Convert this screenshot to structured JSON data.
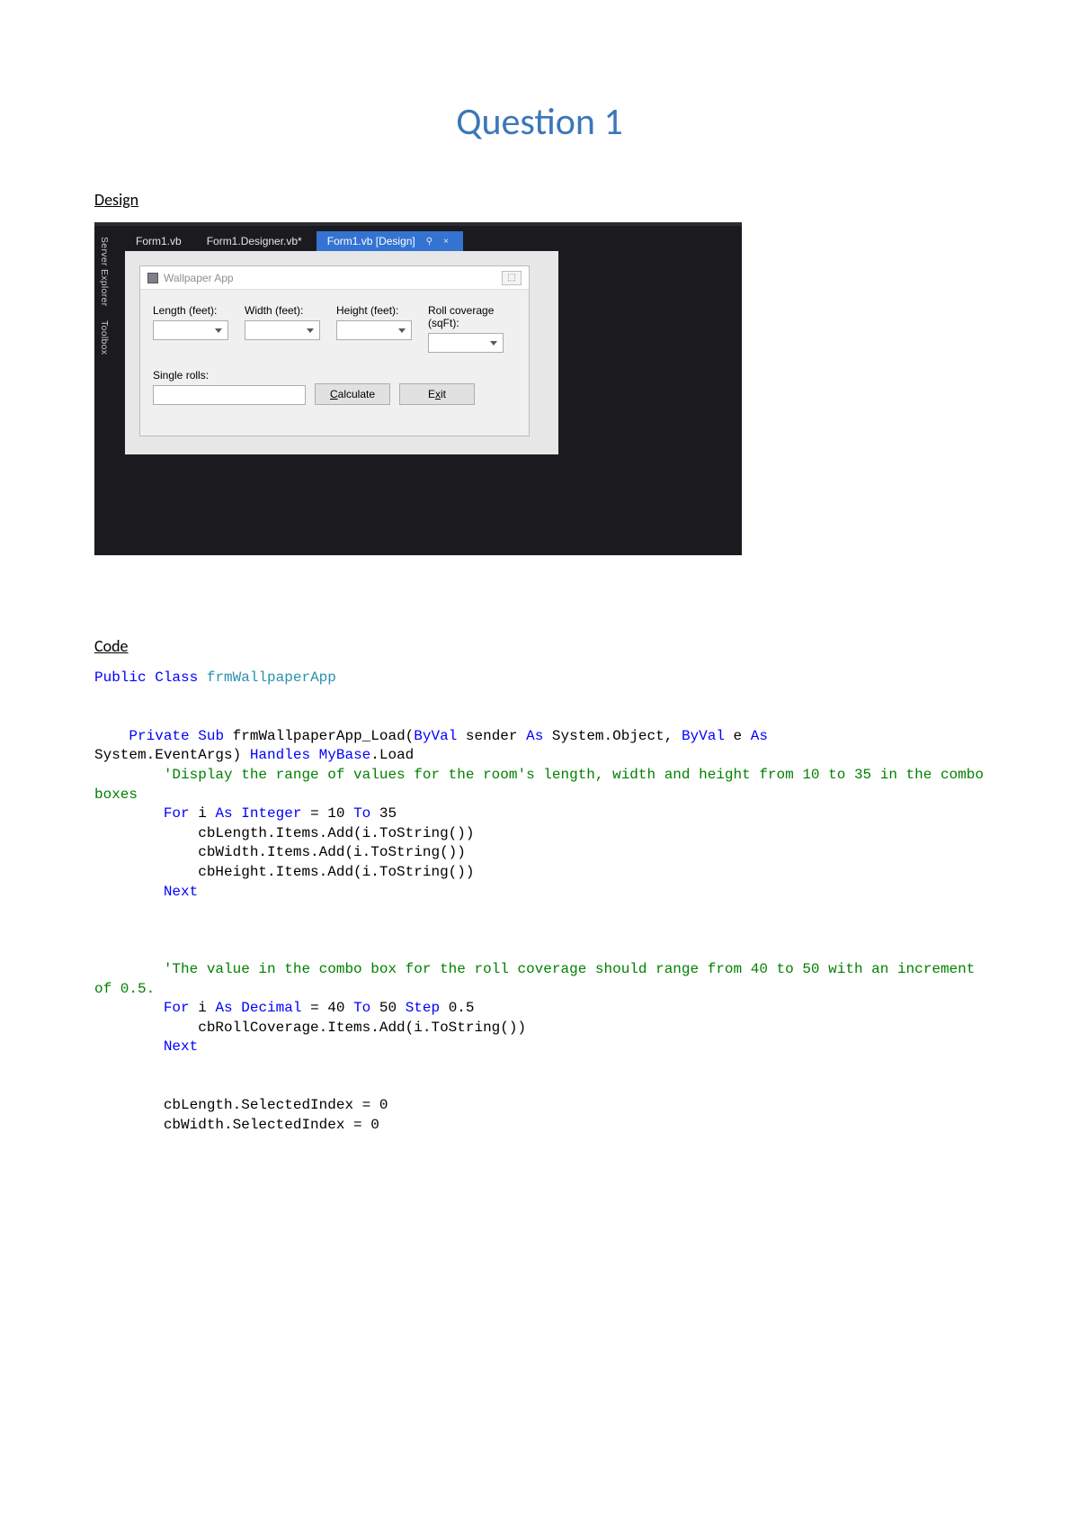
{
  "title": "Question 1",
  "section_design": "Design",
  "section_code": "Code",
  "ide": {
    "sidetabs": [
      "Server Explorer",
      "Toolbox"
    ],
    "tabs": [
      {
        "label": "Form1.vb"
      },
      {
        "label": "Form1.Designer.vb*"
      },
      {
        "label": "Form1.vb [Design]",
        "active": true
      }
    ],
    "tab_pin": "⚲",
    "tab_close": "×",
    "form": {
      "title": "Wallpaper App",
      "winbtn_glyph": "⬚",
      "labels": {
        "length": "Length (feet):",
        "width": "Width (feet):",
        "height": "Height (feet):",
        "roll": "Roll coverage (sqFt):",
        "single": "Single rolls:"
      },
      "buttons": {
        "calculate_pre": "",
        "calculate_mn": "C",
        "calculate_post": "alculate",
        "exit_pre": "E",
        "exit_mn": "x",
        "exit_post": "it"
      }
    }
  },
  "code": {
    "l1_a": "Public",
    "l1_b": "Class",
    "l1_c": "frmWallpaperApp",
    "l2_a": "Private",
    "l2_b": "Sub",
    "l2_c": " frmWallpaperApp_Load(",
    "l2_d": "ByVal",
    "l2_e": " sender ",
    "l2_f": "As",
    "l2_g": " System.Object, ",
    "l2_h": "ByVal",
    "l2_i": " e ",
    "l2_j": "As",
    "l3_a": "System.EventArgs) ",
    "l3_b": "Handles",
    "l3_c": " ",
    "l3_d": "MyBase",
    "l3_e": ".Load",
    "l4": "        'Display the range of values for the room's length, width and height from 10 to 35 in the combo boxes",
    "l5_a": "For",
    "l5_b": " i ",
    "l5_c": "As",
    "l5_d": " ",
    "l5_e": "Integer",
    "l5_f": " = 10 ",
    "l5_g": "To",
    "l5_h": " 35",
    "l6": "            cbLength.Items.Add(i.ToString())",
    "l7": "            cbWidth.Items.Add(i.ToString())",
    "l8": "            cbHeight.Items.Add(i.ToString())",
    "l9": "Next",
    "l10": "        'The value in the combo box for the roll coverage should range from 40 to 50 with an increment of 0.5.",
    "l11_a": "For",
    "l11_b": " i ",
    "l11_c": "As",
    "l11_d": " ",
    "l11_e": "Decimal",
    "l11_f": " = 40 ",
    "l11_g": "To",
    "l11_h": " 50 ",
    "l11_i": "Step",
    "l11_j": " 0.5",
    "l12": "            cbRollCoverage.Items.Add(i.ToString())",
    "l13": "Next",
    "l14": "        cbLength.SelectedIndex = 0",
    "l15": "        cbWidth.SelectedIndex = 0"
  }
}
